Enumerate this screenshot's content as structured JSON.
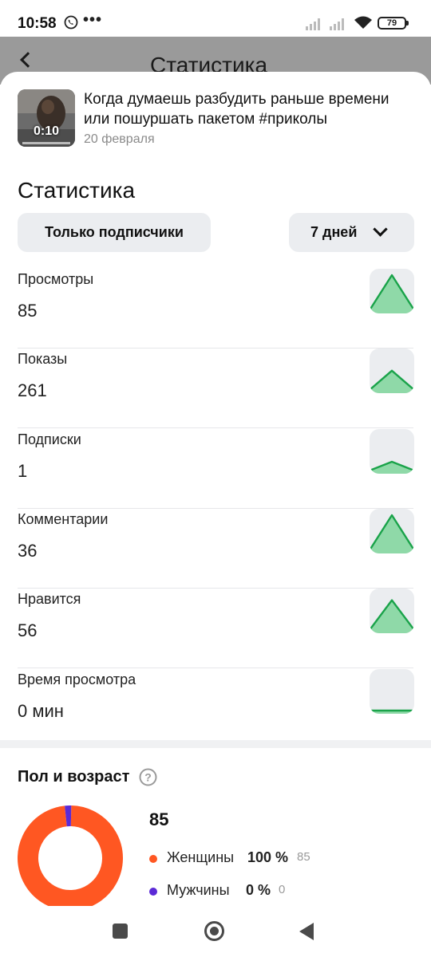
{
  "status_bar": {
    "time": "10:58",
    "dots": "•••",
    "battery": "79",
    "icons": [
      "viber-icon",
      "signal-icon",
      "signal-icon",
      "wifi-icon",
      "battery-icon"
    ]
  },
  "background_page": {
    "title": "Статистика"
  },
  "video": {
    "title": "Когда думаешь разбудить раньше времени или пошуршать пакетом #приколы",
    "date": "20 февраля",
    "duration": "0:10"
  },
  "stats_section": {
    "title": "Статистика",
    "filter_audience": "Только подписчики",
    "filter_period": "7 дней"
  },
  "stats": [
    {
      "label": "Просмотры",
      "value": "85",
      "trend": [
        0.0,
        1.0,
        0.0
      ]
    },
    {
      "label": "Показы",
      "value": "261",
      "trend": [
        0.0,
        0.55,
        0.0
      ]
    },
    {
      "label": "Подписки",
      "value": "1",
      "trend": [
        0.0,
        0.25,
        0.0
      ]
    },
    {
      "label": "Комментарии",
      "value": "36",
      "trend": [
        0.0,
        1.0,
        0.0
      ]
    },
    {
      "label": "Нравится",
      "value": "56",
      "trend": [
        0.0,
        0.85,
        0.0
      ]
    },
    {
      "label": "Время просмотра",
      "value": "0 мин",
      "trend": [
        0.0,
        0.0,
        0.0
      ]
    }
  ],
  "demographics": {
    "title": "Пол и возраст",
    "total": "85",
    "items": [
      {
        "label": "Женщины",
        "percent": "100 %",
        "count": "85",
        "share": 0.98,
        "color": "#ff5722"
      },
      {
        "label": "Мужчины",
        "percent": "0 %",
        "count": "0",
        "share": 0.02,
        "color": "#5b2ad6"
      }
    ]
  },
  "colors": {
    "accent_green": "#1aa34a",
    "green_fill": "#8fd9a8",
    "chip_bg": "#ebedf0"
  }
}
